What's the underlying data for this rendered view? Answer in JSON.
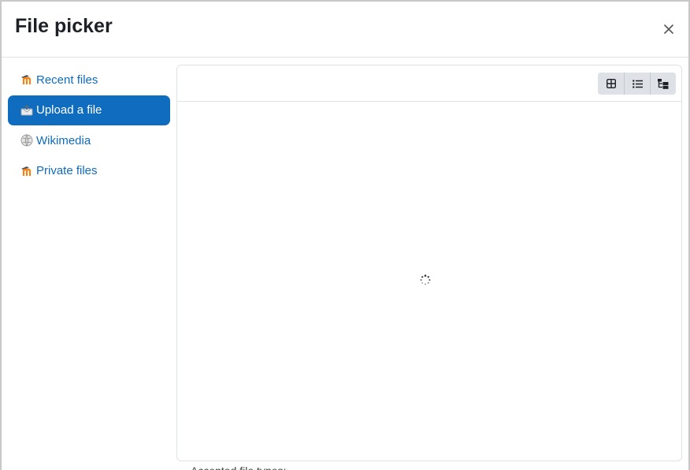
{
  "dialog": {
    "title": "File picker",
    "close_icon": "close-icon"
  },
  "sidebar": {
    "items": [
      {
        "label": "Recent files",
        "icon": "moodle-icon",
        "active": false
      },
      {
        "label": "Upload a file",
        "icon": "upload-icon",
        "active": true
      },
      {
        "label": "Wikimedia",
        "icon": "wikimedia-icon",
        "active": false
      },
      {
        "label": "Private files",
        "icon": "moodle-icon",
        "active": false
      }
    ]
  },
  "toolbar": {
    "views": [
      "icon-view-icon",
      "list-view-icon",
      "tree-view-icon"
    ]
  },
  "colors": {
    "accent": "#0f6cbf",
    "border": "#dee2e6",
    "title": "#1d2125"
  },
  "behind": {
    "text": "Accepted file types:"
  }
}
